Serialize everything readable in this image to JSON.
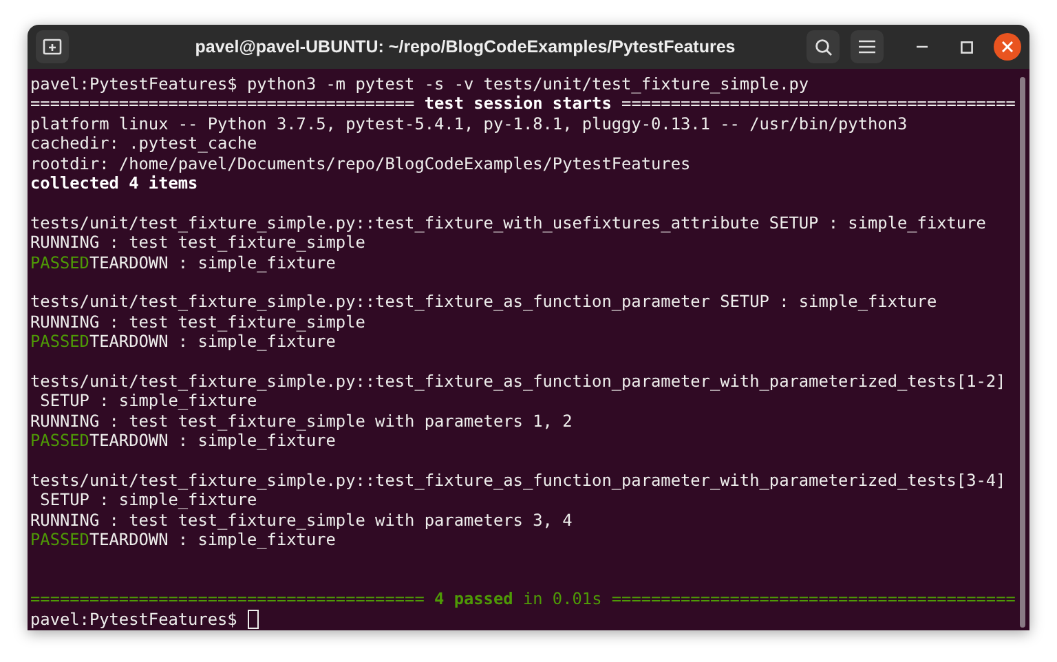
{
  "window": {
    "title": "pavel@pavel-UBUNTU: ~/repo/BlogCodeExamples/PytestFeatures"
  },
  "terminal": {
    "lines": [
      {
        "kind": "text",
        "segments": [
          {
            "kind": "plain",
            "text": "pavel:PytestFeatures$ python3 -m pytest -s -v tests/unit/test_fixture_simple.py"
          }
        ]
      },
      {
        "kind": "text",
        "segments": [
          {
            "kind": "plain",
            "text": "======================================="
          },
          {
            "kind": "bold",
            "text": " test session starts "
          },
          {
            "kind": "plain",
            "text": "========================================"
          }
        ]
      },
      {
        "kind": "text",
        "segments": [
          {
            "kind": "plain",
            "text": "platform linux -- Python 3.7.5, pytest-5.4.1, py-1.8.1, pluggy-0.13.1 -- /usr/bin/python3"
          }
        ]
      },
      {
        "kind": "text",
        "segments": [
          {
            "kind": "plain",
            "text": "cachedir: .pytest_cache"
          }
        ]
      },
      {
        "kind": "text",
        "segments": [
          {
            "kind": "plain",
            "text": "rootdir: /home/pavel/Documents/repo/BlogCodeExamples/PytestFeatures"
          }
        ]
      },
      {
        "kind": "text",
        "segments": [
          {
            "kind": "bold",
            "text": "collected 4 items"
          }
        ]
      },
      {
        "kind": "blank"
      },
      {
        "kind": "text",
        "segments": [
          {
            "kind": "plain",
            "text": "tests/unit/test_fixture_simple.py::test_fixture_with_usefixtures_attribute SETUP : simple_fixture"
          }
        ]
      },
      {
        "kind": "text",
        "segments": [
          {
            "kind": "plain",
            "text": "RUNNING : test test_fixture_simple"
          }
        ]
      },
      {
        "kind": "text",
        "segments": [
          {
            "kind": "green",
            "text": "PASSED"
          },
          {
            "kind": "plain",
            "text": "TEARDOWN : simple_fixture"
          }
        ]
      },
      {
        "kind": "blank"
      },
      {
        "kind": "text",
        "segments": [
          {
            "kind": "plain",
            "text": "tests/unit/test_fixture_simple.py::test_fixture_as_function_parameter SETUP : simple_fixture"
          }
        ]
      },
      {
        "kind": "text",
        "segments": [
          {
            "kind": "plain",
            "text": "RUNNING : test test_fixture_simple"
          }
        ]
      },
      {
        "kind": "text",
        "segments": [
          {
            "kind": "green",
            "text": "PASSED"
          },
          {
            "kind": "plain",
            "text": "TEARDOWN : simple_fixture"
          }
        ]
      },
      {
        "kind": "blank"
      },
      {
        "kind": "text",
        "segments": [
          {
            "kind": "plain",
            "text": "tests/unit/test_fixture_simple.py::test_fixture_as_function_parameter_with_parameterized_tests[1-2]"
          }
        ]
      },
      {
        "kind": "text",
        "segments": [
          {
            "kind": "plain",
            "text": " SETUP : simple_fixture"
          }
        ]
      },
      {
        "kind": "text",
        "segments": [
          {
            "kind": "plain",
            "text": "RUNNING : test test_fixture_simple with parameters 1, 2"
          }
        ]
      },
      {
        "kind": "text",
        "segments": [
          {
            "kind": "green",
            "text": "PASSED"
          },
          {
            "kind": "plain",
            "text": "TEARDOWN : simple_fixture"
          }
        ]
      },
      {
        "kind": "blank"
      },
      {
        "kind": "text",
        "segments": [
          {
            "kind": "plain",
            "text": "tests/unit/test_fixture_simple.py::test_fixture_as_function_parameter_with_parameterized_tests[3-4]"
          }
        ]
      },
      {
        "kind": "text",
        "segments": [
          {
            "kind": "plain",
            "text": " SETUP : simple_fixture"
          }
        ]
      },
      {
        "kind": "text",
        "segments": [
          {
            "kind": "plain",
            "text": "RUNNING : test test_fixture_simple with parameters 3, 4"
          }
        ]
      },
      {
        "kind": "text",
        "segments": [
          {
            "kind": "green",
            "text": "PASSED"
          },
          {
            "kind": "plain",
            "text": "TEARDOWN : simple_fixture"
          }
        ]
      },
      {
        "kind": "blank"
      },
      {
        "kind": "blank"
      },
      {
        "kind": "text",
        "segments": [
          {
            "kind": "green",
            "text": "======================================== "
          },
          {
            "kind": "green-bold",
            "text": "4 passed"
          },
          {
            "kind": "green",
            "text": " in 0.01s ========================================="
          }
        ]
      },
      {
        "kind": "prompt",
        "segments": [
          {
            "kind": "plain",
            "text": "pavel:PytestFeatures$ "
          }
        ]
      }
    ]
  }
}
